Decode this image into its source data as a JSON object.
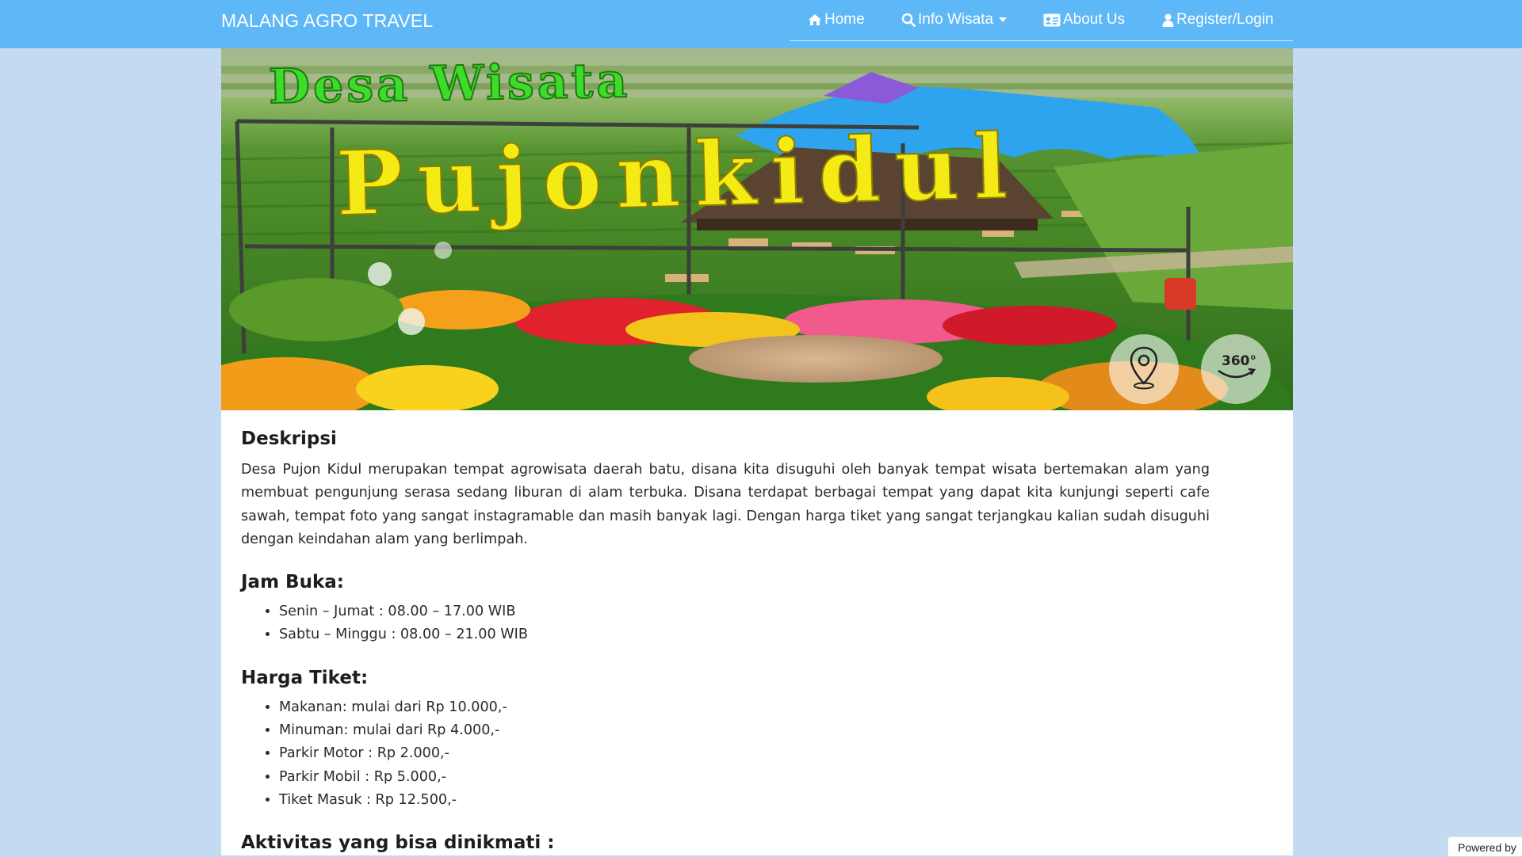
{
  "navbar": {
    "brand": "MALANG AGRO TRAVEL",
    "items": [
      {
        "label": "Home",
        "icon": "home-icon"
      },
      {
        "label": "Info Wisata",
        "icon": "search-icon",
        "dropdown": true
      },
      {
        "label": "About Us",
        "icon": "id-card-icon"
      },
      {
        "label": "Register/Login",
        "icon": "user-icon"
      }
    ],
    "bg_color": "#5eb7f7"
  },
  "hero": {
    "title_line1": "Desa Wisata",
    "title_line2": "Pujonkidul",
    "map_button_icon": "map-pin-icon",
    "view360_label": "360°"
  },
  "main": {
    "desc_heading": "Deskripsi",
    "desc_text": "Desa Pujon Kidul merupakan tempat agrowisata daerah batu, disana kita disuguhi oleh banyak tempat wisata bertemakan alam yang membuat pengunjung serasa sedang liburan di alam terbuka. Disana terdapat berbagai tempat yang dapat kita kunjungi seperti cafe sawah, tempat foto yang sangat instagramable dan masih banyak lagi. Dengan harga tiket yang sangat terjangkau kalian sudah disuguhi dengan keindahan alam yang berlimpah.",
    "hours_heading": "Jam Buka:",
    "hours": [
      "Senin – Jumat : 08.00 – 17.00 WIB",
      "Sabtu – Minggu : 08.00 – 21.00 WIB"
    ],
    "price_heading": "Harga Tiket:",
    "prices": [
      "Makanan: mulai dari Rp 10.000,-",
      "Minuman: mulai dari Rp 4.000,-",
      "Parkir Motor : Rp 2.000,-",
      "Parkir Mobil : Rp 5.000,-",
      "Tiket Masuk : Rp 12.500,-"
    ],
    "activities_heading": "Aktivitas yang bisa dinikmati :"
  },
  "footer": {
    "powered_by": "Powered by"
  }
}
